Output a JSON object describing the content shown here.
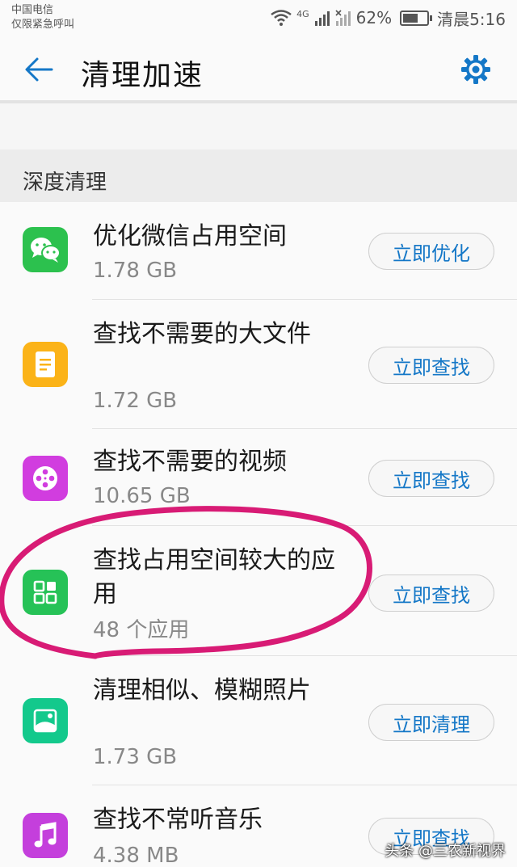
{
  "status_bar": {
    "carrier_line1": "中国电信",
    "carrier_line2": "仅限紧急呼叫",
    "network": "4G",
    "battery": "62%",
    "time": "清晨5:16"
  },
  "header": {
    "title": "清理加速",
    "back_icon": "arrow-left",
    "settings_icon": "gear",
    "accent": "#1477c7"
  },
  "section": {
    "title": "深度清理"
  },
  "items": [
    {
      "title": "优化微信占用空间",
      "subtitle": "1.78 GB",
      "button": "立即优化",
      "icon": "wechat-icon",
      "color": "#2cc14e"
    },
    {
      "title": "查找不需要的大文件",
      "subtitle": "1.72 GB",
      "button": "立即查找",
      "icon": "document-icon",
      "color": "#fbb318"
    },
    {
      "title": "查找不需要的视频",
      "subtitle": "10.65 GB",
      "button": "立即查找",
      "icon": "film-reel-icon",
      "color": "#d13ddf"
    },
    {
      "title": "查找占用空间较大的应用",
      "subtitle": "48 个应用",
      "button": "立即查找",
      "icon": "app-grid-icon",
      "color": "#26c257"
    },
    {
      "title": "清理相似、模糊照片",
      "subtitle": "1.73 GB",
      "button": "立即清理",
      "icon": "photo-icon",
      "color": "#13c98c"
    },
    {
      "title": "查找不常听音乐",
      "subtitle": "4.38 MB",
      "button": "立即查找",
      "icon": "music-note-icon",
      "color": "#c43fdc"
    }
  ],
  "annotation_color": "#d81b75",
  "watermark": "头条 @三农新视界"
}
